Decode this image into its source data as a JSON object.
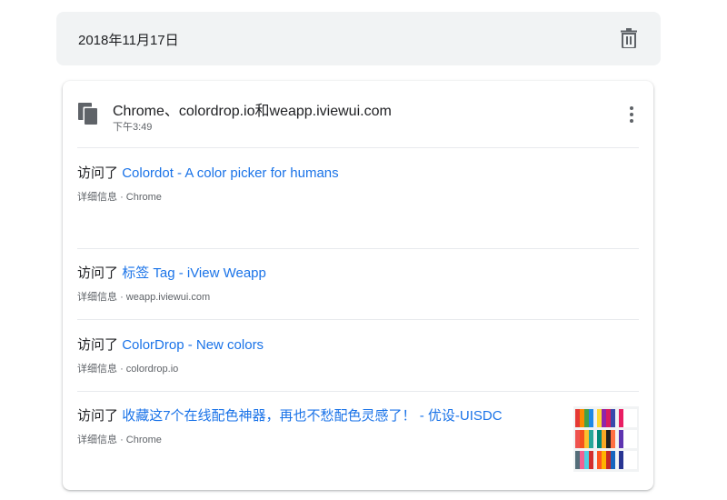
{
  "date_header": {
    "date": "2018年11月17日",
    "delete_icon": "trash-icon"
  },
  "group": {
    "icon": "copy-icon",
    "title": "Chrome、colordrop.io和weapp.iviewui.com",
    "time": "下午3:49",
    "menu_icon": "more-vert-icon"
  },
  "entries": [
    {
      "prefix": "访问了",
      "title": "Colordot - A color picker for humans",
      "details": "详细信息",
      "separator": "·",
      "source": "Chrome"
    },
    {
      "prefix": "访问了",
      "title": "标签 Tag - iView Weapp",
      "details": "详细信息",
      "separator": "·",
      "source": "weapp.iviewui.com"
    },
    {
      "prefix": "访问了",
      "title": "ColorDrop - New colors",
      "details": "详细信息",
      "separator": "·",
      "source": "colordrop.io"
    },
    {
      "prefix": "访问了",
      "title": "收藏这7个在线配色神器，再也不愁配色灵感了！ - 优设-UISDC",
      "details": "详细信息",
      "separator": "·",
      "source": "Chrome"
    }
  ],
  "colors": {
    "link": "#1a73e8",
    "date_bar_bg": "#f1f3f4",
    "secondary_text": "#5f6368"
  }
}
